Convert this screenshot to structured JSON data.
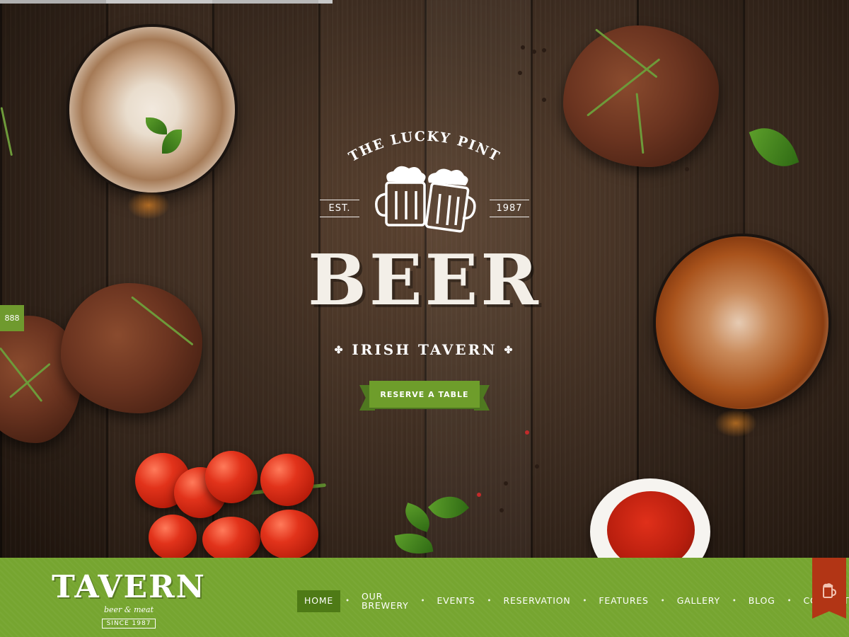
{
  "brand": {
    "tagline_arc": "THE LUCKY PINT",
    "est_label": "EST.",
    "est_year": "1987",
    "hero_word": "BEER",
    "hero_subtitle": "IRISH TAVERN",
    "clover_glyph": "✤"
  },
  "hero": {
    "cta_label": "RESERVE A TABLE",
    "side_tab_label": "888"
  },
  "logo": {
    "name": "TAVERN",
    "subtitle": "beer & meat",
    "since": "SINCE 1987"
  },
  "nav": {
    "items": [
      {
        "label": "HOME",
        "active": true
      },
      {
        "label": "OUR BREWERY"
      },
      {
        "label": "EVENTS"
      },
      {
        "label": "RESERVATION"
      },
      {
        "label": "FEATURES"
      },
      {
        "label": "GALLERY"
      },
      {
        "label": "BLOG"
      },
      {
        "label": "CONTACTS"
      }
    ],
    "separator": "•"
  },
  "colors": {
    "accent_green": "#76a530",
    "active_green": "#4e7a16",
    "ribbon_red": "#b23515",
    "wood": "#3a2a1f"
  },
  "icons": {
    "cart": "beer-mug-icon",
    "logo_mugs": "beer-mugs-icon"
  }
}
